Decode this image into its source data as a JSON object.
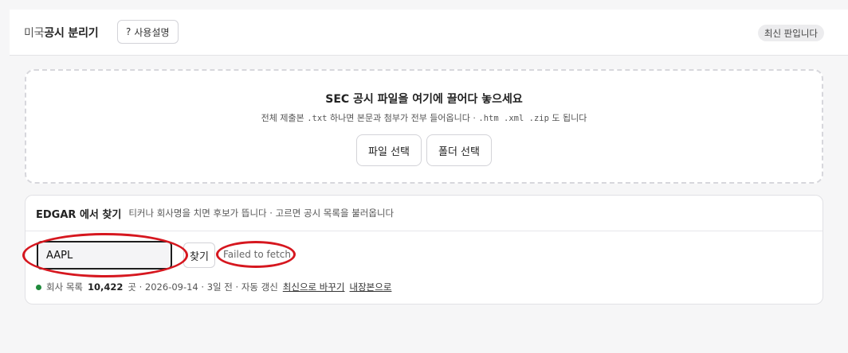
{
  "header": {
    "brand_prefix": "미국",
    "brand_main": "공시 분리기",
    "help_icon": "?",
    "help_label": "사용설명",
    "version_badge": "최신 판입니다"
  },
  "dropzone": {
    "title": "SEC 공시 파일을 여기에 끌어다 놓으세요",
    "sub_prefix": "전체 제출본",
    "sub_ext_txt": ".txt",
    "sub_middle": "하나면 본문과 첨부가 전부 들어옵니다 ·",
    "sub_ext_others": ".htm .xml .zip",
    "sub_suffix": "도 됩니다",
    "file_button": "파일 선택",
    "folder_button": "폴더 선택"
  },
  "edgar": {
    "title": "EDGAR 에서 찾기",
    "hint": "티커나 회사명을 치면 후보가 뜹니다 · 고르면 공시 목록을 불러옵니다",
    "ticker_value": "AAPL",
    "find_button": "찾기",
    "error": "Failed to fetch",
    "status": {
      "label": "회사 목록",
      "count": "10,422",
      "unit_date": "곳 · 2026-09-14 · 3일 전 · 자동 갱신",
      "refresh_link": "최신으로 바꾸기",
      "builtin_link": "내장본으로",
      "dot_color": "#1f8a3b"
    }
  },
  "annotation_color": "#d6171f"
}
